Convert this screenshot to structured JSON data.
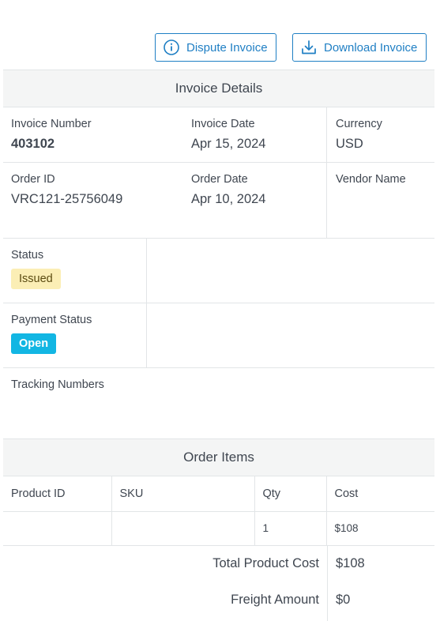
{
  "actions": {
    "dispute_label": "Dispute Invoice",
    "download_label": "Download Invoice"
  },
  "invoice_details": {
    "header": "Invoice Details",
    "invoice_number_label": "Invoice Number",
    "invoice_number": "403102",
    "invoice_date_label": "Invoice Date",
    "invoice_date": "Apr 15, 2024",
    "currency_label": "Currency",
    "currency": "USD",
    "order_id_label": "Order ID",
    "order_id": "VRC121-25756049",
    "order_date_label": "Order Date",
    "order_date": "Apr 10, 2024",
    "vendor_name_label": "Vendor Name",
    "vendor_name": "",
    "status_label": "Status",
    "status": "Issued",
    "payment_status_label": "Payment Status",
    "payment_status": "Open",
    "tracking_numbers_label": "Tracking Numbers",
    "tracking_numbers": ""
  },
  "order_items": {
    "header": "Order Items",
    "columns": [
      "Product ID",
      "SKU",
      "Qty",
      "Cost"
    ],
    "rows": [
      {
        "product_id": "",
        "sku": "",
        "qty": "1",
        "cost": "$108"
      }
    ],
    "totals": [
      {
        "label": "Total Product Cost",
        "value": "$108"
      },
      {
        "label": "Freight Amount",
        "value": "$0"
      }
    ]
  },
  "colors": {
    "accent": "#1f7fc4",
    "issued_badge": "#fbeeb5",
    "open_badge": "#12b6e3",
    "header_bg": "#f4f5f5",
    "border": "#e2e5e7"
  },
  "icons": {
    "dispute": "info-circle-icon",
    "download": "download-tray-icon"
  }
}
